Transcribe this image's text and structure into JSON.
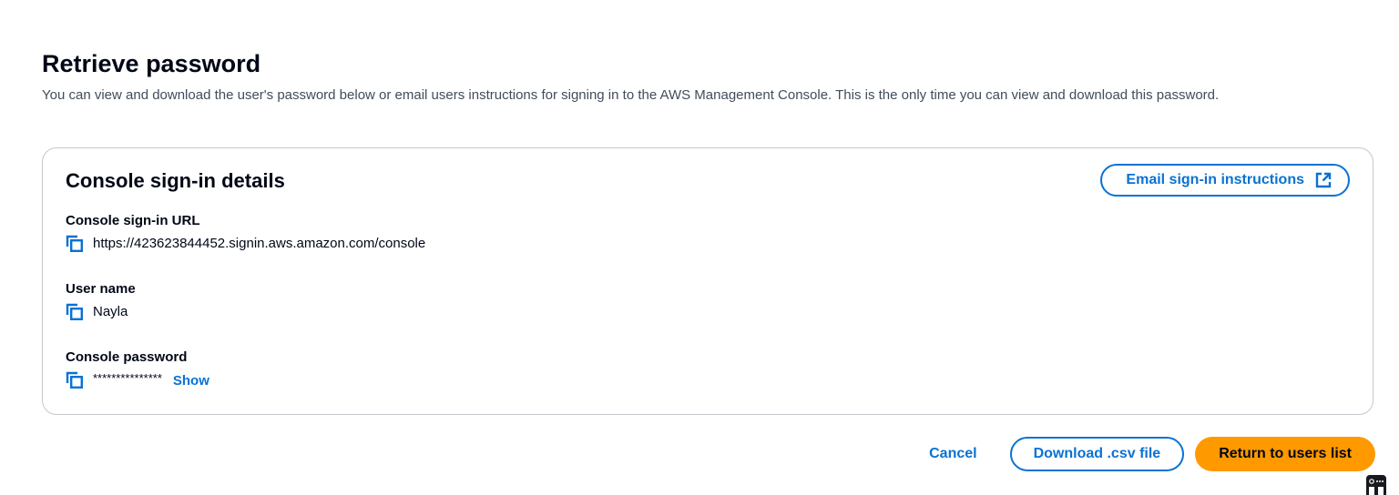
{
  "header": {
    "title": "Retrieve password",
    "description": "You can view and download the user's password below or email users instructions for signing in to the AWS Management Console. This is the only time you can view and download this password."
  },
  "card": {
    "title": "Console sign-in details",
    "email_button_label": "Email sign-in instructions",
    "fields": [
      {
        "label": "Console sign-in URL",
        "value": "https://423623844452.signin.aws.amazon.com/console"
      },
      {
        "label": "User name",
        "value": "Nayla"
      },
      {
        "label": "Console password",
        "value": "***************",
        "show_label": "Show"
      }
    ]
  },
  "footer": {
    "cancel_label": "Cancel",
    "download_label": "Download .csv file",
    "return_label": "Return to users list"
  },
  "colors": {
    "link_blue": "#0972d3",
    "primary_orange": "#ff9900",
    "card_border": "#c6c6cd"
  },
  "icons": {
    "copy": "copy-icon",
    "external": "external-link-icon"
  }
}
